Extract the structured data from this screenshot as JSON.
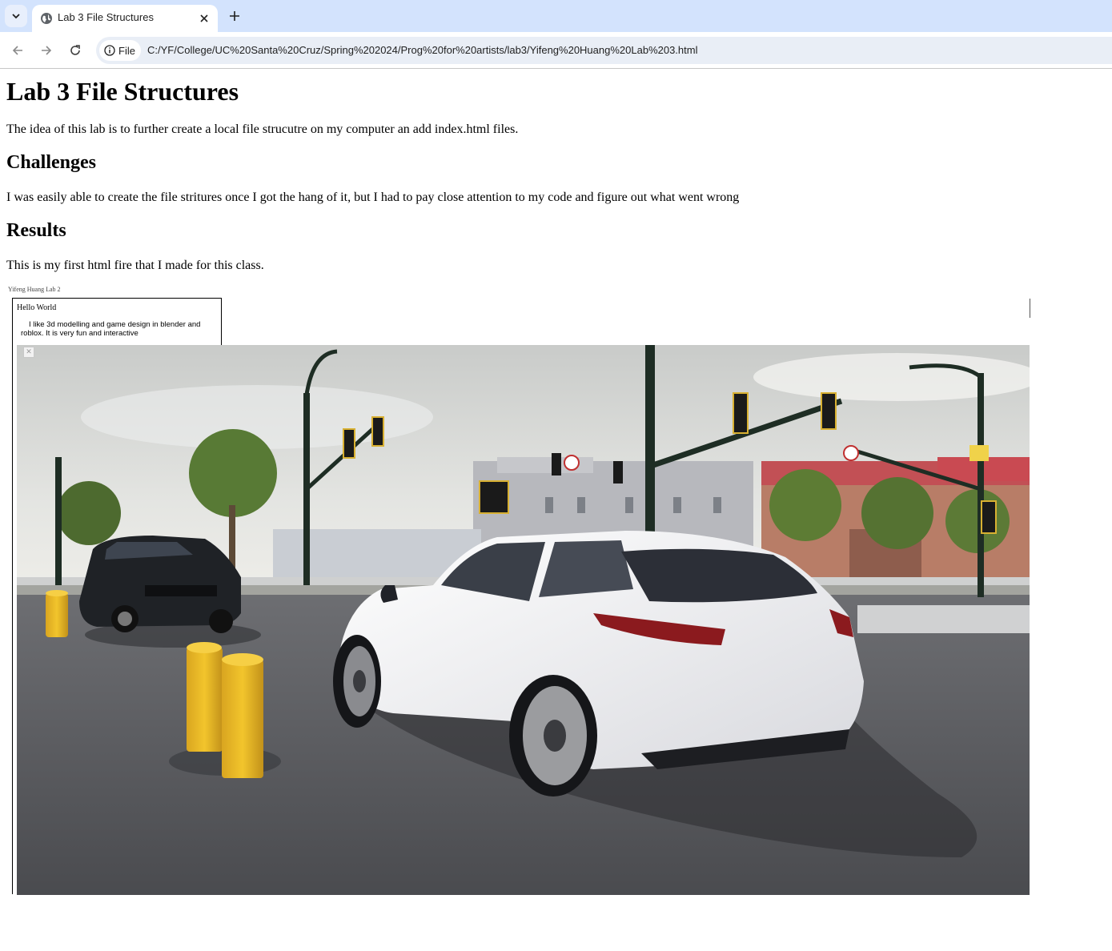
{
  "browser": {
    "tab": {
      "title": "Lab 3 File Structures"
    },
    "address_bar": {
      "site_chip_label": "File",
      "url": "C:/YF/College/UC%20Santa%20Cruz/Spring%202024/Prog%20for%20artists/lab3/Yifeng%20Huang%20Lab%203.html"
    }
  },
  "page": {
    "title": "Lab 3 File Structures",
    "intro": "The idea of this lab is to further create a local file strucutre on my computer an add index.html files.",
    "challenges_heading": "Challenges",
    "challenges_text": "I was easily able to create the file stritures once I got the hang of it, but I had to pay close attention to my code and figure out what went wrong",
    "results_heading": "Results",
    "results_text": "This is my first html fire that I made for this class.",
    "embed": {
      "label": "Yifeng Huang Lab 2",
      "heading": "Hello World",
      "text": "I like 3d modelling and game design in blender and roblox. It is very fun and interactive"
    }
  }
}
